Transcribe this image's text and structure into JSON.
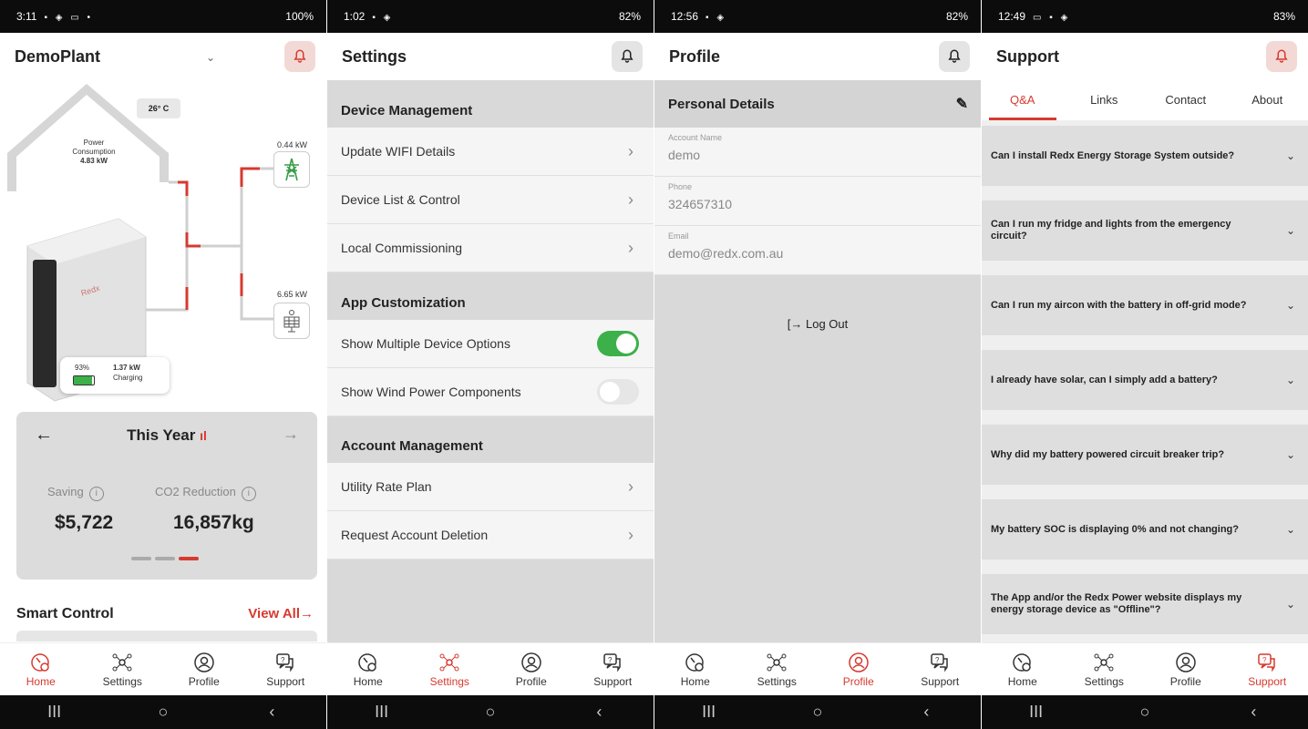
{
  "colors": {
    "accent": "#d63a2f",
    "toggle_on": "#3cb14a"
  },
  "nav": {
    "home": "Home",
    "settings": "Settings",
    "profile": "Profile",
    "support": "Support"
  },
  "system_nav": {
    "recents": "III",
    "home": "○",
    "back": "‹"
  },
  "screen1": {
    "status": {
      "time": "3:11",
      "right": "100%"
    },
    "title": "DemoPlant",
    "temperature": "26° C",
    "consumption": {
      "label": "Power Consumption",
      "value": "4.83 kW"
    },
    "grid_kw": "0.44 kW",
    "solar_kw": "6.65 kW",
    "battery": {
      "soc": "93%",
      "kw": "1.37 kW",
      "status": "Charging"
    },
    "brand": "Redx",
    "period": "This Year",
    "saving_label": "Saving",
    "saving_value": "$5,722",
    "co2_label": "CO2 Reduction",
    "co2_value": "16,857kg",
    "smart_control": "Smart Control",
    "view_all": "View All→"
  },
  "screen2": {
    "status": {
      "time": "1:02",
      "right": "82%"
    },
    "title": "Settings",
    "sections": {
      "device": "Device Management",
      "app": "App Customization",
      "account": "Account Management"
    },
    "items": {
      "wifi": "Update WIFI Details",
      "devices": "Device List & Control",
      "commissioning": "Local Commissioning",
      "multi": "Show Multiple Device Options",
      "wind": "Show Wind Power Components",
      "rate": "Utility Rate Plan",
      "delete": "Request Account Deletion"
    },
    "toggles": {
      "multi": true,
      "wind": false
    }
  },
  "screen3": {
    "status": {
      "time": "12:56",
      "right": "82%"
    },
    "title": "Profile",
    "section": "Personal Details",
    "fields": [
      {
        "label": "Account Name",
        "value": "demo"
      },
      {
        "label": "Phone",
        "value": "324657310"
      },
      {
        "label": "Email",
        "value": "demo@redx.com.au"
      }
    ],
    "logout": "Log Out"
  },
  "screen4": {
    "status": {
      "time": "12:49",
      "right": "83%"
    },
    "title": "Support",
    "tabs": [
      "Q&A",
      "Links",
      "Contact",
      "About"
    ],
    "faqs": [
      "Can I install Redx Energy Storage System outside?",
      "Can I run my fridge and lights from the emergency circuit?",
      "Can I run my aircon with the battery in off-grid mode?",
      "I already have solar, can I simply add a battery?",
      "Why did my battery powered circuit breaker trip?",
      "My battery SOC is displaying 0% and not changing?",
      "The App and/or the Redx Power website displays my energy storage device as \"Offline\"?"
    ]
  }
}
